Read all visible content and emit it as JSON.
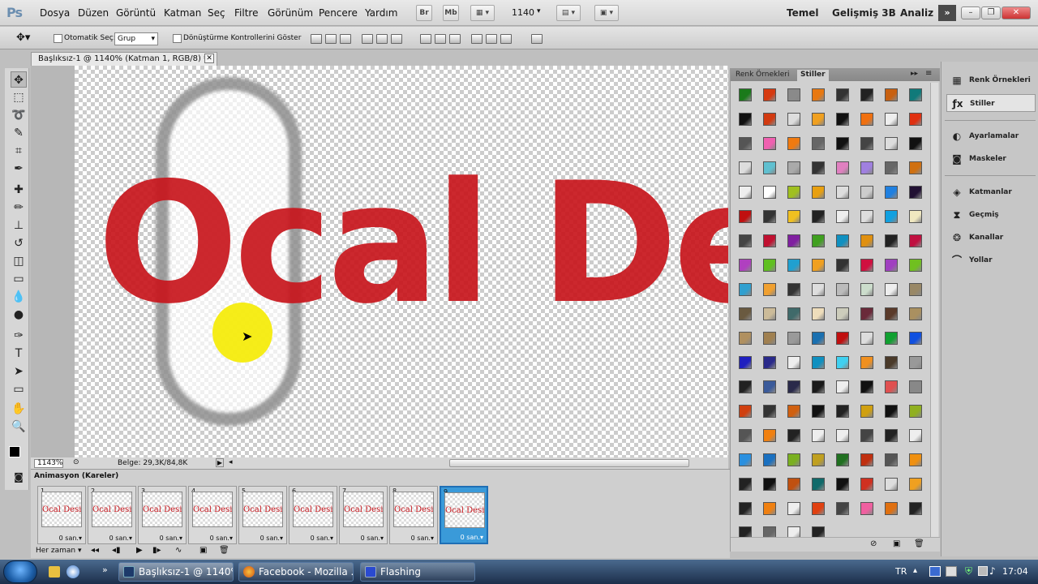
{
  "app": {
    "logo": "Ps"
  },
  "menu": [
    "Dosya",
    "Düzen",
    "Görüntü",
    "Katman",
    "Seç",
    "Filtre",
    "Görünüm",
    "Pencere",
    "Yardım"
  ],
  "menubar": {
    "br": "Br",
    "mb": "Mb",
    "zoom": "1140"
  },
  "workspaces": [
    "Temel",
    "Gelişmiş 3B",
    "Analiz"
  ],
  "options": {
    "auto_select_label": "Otomatik Seç:",
    "auto_select_value": "Grup",
    "transform_label": "Dönüştürme Kontrollerini Göster"
  },
  "document": {
    "tab_title": "Başlıksız-1 @ 1140% (Katman 1, RGB/8) *",
    "canvas_text": "Ocal Des",
    "zoom": "1143%",
    "doc_size": "Belge: 29,3K/84,8K"
  },
  "animation": {
    "title": "Animasyon (Kareler)",
    "loop": "Her zaman",
    "frames": [
      {
        "num": "1",
        "thumb": "Ocal Design",
        "time": "0 san."
      },
      {
        "num": "2",
        "thumb": "Ocal Design",
        "time": "0 san."
      },
      {
        "num": "3",
        "thumb": "Ocal Design",
        "time": "0 san."
      },
      {
        "num": "4",
        "thumb": "Ocal Design",
        "time": "0 san."
      },
      {
        "num": "5",
        "thumb": "Ocal Design",
        "time": "0 san."
      },
      {
        "num": "6",
        "thumb": "Ocal Design",
        "time": "0 san."
      },
      {
        "num": "7",
        "thumb": "Ocal Design",
        "time": "0 san."
      },
      {
        "num": "8",
        "thumb": "Ocal Design",
        "time": "0 san."
      },
      {
        "num": "9",
        "thumb": "Ocal Design",
        "time": "0 san."
      }
    ],
    "selected_frame": "9"
  },
  "styles_panel": {
    "tabs": [
      "Renk Örnekleri",
      "Stiller"
    ],
    "active_tab": "Stiller",
    "swatch_colors": [
      "#1a7a1a",
      "#d63a10",
      "#8a8a8a",
      "#e87810",
      "#333333",
      "#222222",
      "#c86010",
      "#107a7a",
      "#111111",
      "#d23a10",
      "#dddddd",
      "#f0a020",
      "#111111",
      "#f07010",
      "#eeeeee",
      "#e03010",
      "#555555",
      "#f060b0",
      "#f07a10",
      "#666666",
      "#111111",
      "#444444",
      "#dddddd",
      "#111111",
      "#dddddd",
      "#60c0d0",
      "#aaaaaa",
      "#333333",
      "#e080c0",
      "#a080e0",
      "#666666",
      "#d07010",
      "#eeeeee",
      "#ffffff",
      "#a0c020",
      "#e8a010",
      "#dddddd",
      "#cccccc",
      "#2080e0",
      "#221133",
      "#c01010",
      "#333333",
      "#f0c020",
      "#222222",
      "#eeeeee",
      "#dddddd",
      "#10a0e0",
      "#f0e8c0",
      "#444444",
      "#c01030",
      "#8020a0",
      "#40a020",
      "#1090c0",
      "#e09010",
      "#222222",
      "#c01040",
      "#b040c0",
      "#60c020",
      "#20a0d0",
      "#f0a020",
      "#333333",
      "#d01040",
      "#a040c0",
      "#70c020",
      "#30a0d0",
      "#f0a030",
      "#333333",
      "#dddddd",
      "#bbbbbb",
      "#ccddcc",
      "#eeeeee",
      "#998866",
      "#6a5a40",
      "#ccbb99",
      "#406a6a",
      "#eeddbb",
      "#ccccbb",
      "#6a2a3a",
      "#5a3a2a",
      "#aa9060",
      "#b09060",
      "#a08050",
      "#9a9a9a",
      "#1a70b0",
      "#c01010",
      "#dddddd",
      "#10a030",
      "#1050e0",
      "#2020c0",
      "#2a2a8a",
      "#eeeeee",
      "#1090c0",
      "#40d0f0",
      "#f09020",
      "#4a3a2a",
      "#999999",
      "#222222",
      "#3a5a9a",
      "#2a2a4a",
      "#1a1a1a",
      "#eeeeee",
      "#111111",
      "#e05050",
      "#888888",
      "#d04010",
      "#333333",
      "#d06010",
      "#111111",
      "#222222",
      "#d0a010",
      "#111111",
      "#90b020",
      "#555555",
      "#f08010",
      "#222222",
      "#eeeeee",
      "#eeeeee",
      "#444444",
      "#222222",
      "#eeeeee",
      "#2a90e0",
      "#1a70c0",
      "#7ab020",
      "#c0a020",
      "#207020",
      "#c03010",
      "#555555",
      "#f09010",
      "#222222",
      "#111111",
      "#c05010",
      "#106a6a",
      "#111111",
      "#d03020",
      "#dddddd",
      "#f0a020",
      "#222222",
      "#f08010",
      "#eeeeee",
      "#e04010",
      "#444444",
      "#f060a0",
      "#e07010",
      "#222222",
      "#222222",
      "#666666",
      "#eeeeee",
      "#222222"
    ]
  },
  "dock": {
    "items": [
      {
        "label": "Renk Örnekleri"
      },
      {
        "label": "Stiller"
      },
      {
        "label": "Ayarlamalar"
      },
      {
        "label": "Maskeler"
      },
      {
        "label": "Katmanlar"
      },
      {
        "label": "Geçmiş"
      },
      {
        "label": "Kanallar"
      },
      {
        "label": "Yollar"
      }
    ]
  },
  "taskbar": {
    "items": [
      {
        "label": "Başlıksız-1 @ 1140%..."
      },
      {
        "label": "Facebook - Mozilla ..."
      },
      {
        "label": "Flashing"
      }
    ],
    "lang": "TR",
    "time": "17:04"
  },
  "colors": {
    "accent": "#1f6fb5",
    "brand_text": "#c8161d"
  }
}
